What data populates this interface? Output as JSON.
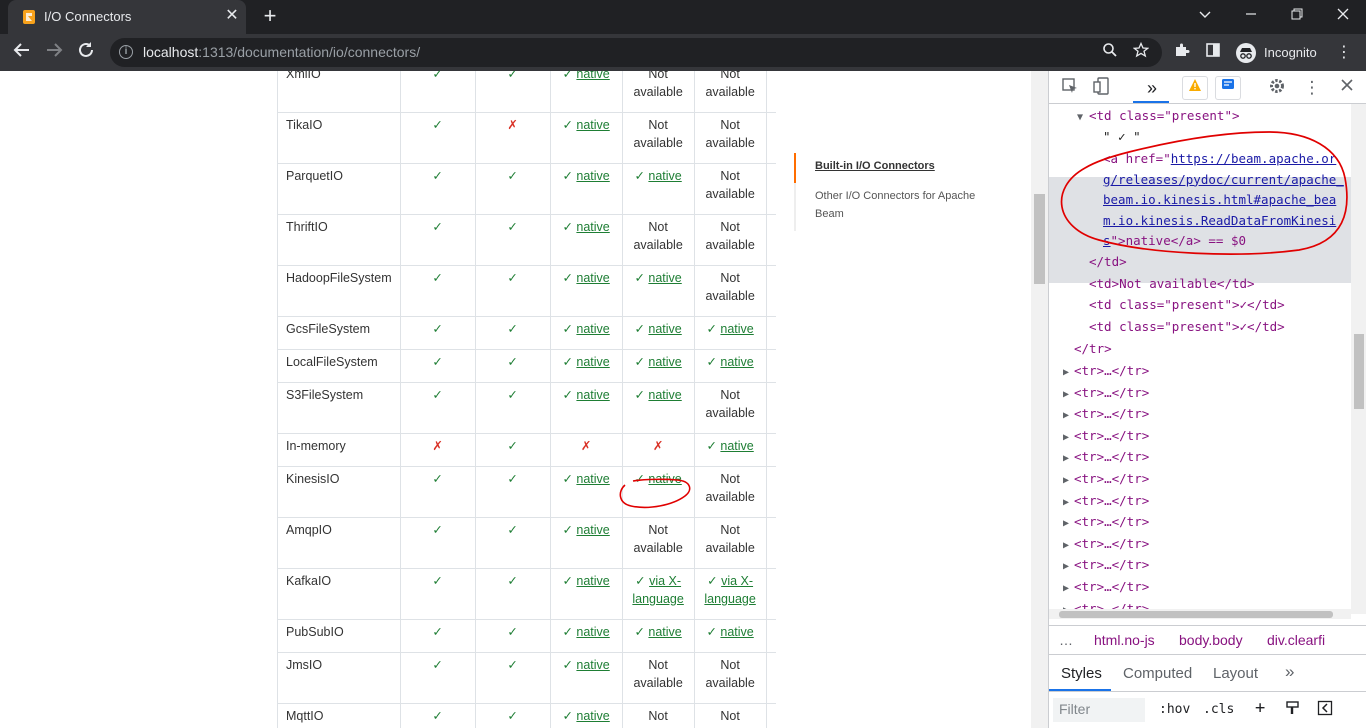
{
  "browser": {
    "tab_title": "I/O Connectors",
    "tab_close": "✕",
    "new_tab": "+",
    "url_host": "localhost",
    "url_path": ":1313/documentation/io/connectors/",
    "profile_label": "Incognito"
  },
  "connectors_table": {
    "rows": [
      {
        "name": "XmlIO",
        "c1": "✓",
        "c2": "✓",
        "c3": "native",
        "c4": "Not available",
        "c5": "Not available"
      },
      {
        "name": "TikaIO",
        "c1": "✓",
        "c2": "✗",
        "c3": "native",
        "c4": "Not available",
        "c5": "Not available"
      },
      {
        "name": "ParquetIO",
        "c1": "✓",
        "c2": "✓",
        "c3": "native",
        "c4": "native",
        "c5": "Not available"
      },
      {
        "name": "ThriftIO",
        "c1": "✓",
        "c2": "✓",
        "c3": "native",
        "c4": "Not available",
        "c5": "Not available"
      },
      {
        "name": "HadoopFileSystem",
        "c1": "✓",
        "c2": "✓",
        "c3": "native",
        "c4": "native",
        "c5": "Not available"
      },
      {
        "name": "GcsFileSystem",
        "c1": "✓",
        "c2": "✓",
        "c3": "native",
        "c4": "native",
        "c5": "native"
      },
      {
        "name": "LocalFileSystem",
        "c1": "✓",
        "c2": "✓",
        "c3": "native",
        "c4": "native",
        "c5": "native"
      },
      {
        "name": "S3FileSystem",
        "c1": "✓",
        "c2": "✓",
        "c3": "native",
        "c4": "native",
        "c5": "Not available"
      },
      {
        "name": "In-memory",
        "c1": "✗",
        "c2": "✓",
        "c3": "✗",
        "c4": "✗",
        "c5": "native"
      },
      {
        "name": "KinesisIO",
        "c1": "✓",
        "c2": "✓",
        "c3": "native",
        "c4": "native",
        "c5": "Not available"
      },
      {
        "name": "AmqpIO",
        "c1": "✓",
        "c2": "✓",
        "c3": "native",
        "c4": "Not available",
        "c5": "Not available"
      },
      {
        "name": "KafkaIO",
        "c1": "✓",
        "c2": "✓",
        "c3": "native",
        "c4": "via X-language",
        "c5": "via X-language"
      },
      {
        "name": "PubSubIO",
        "c1": "✓",
        "c2": "✓",
        "c3": "native",
        "c4": "native",
        "c5": "native"
      },
      {
        "name": "JmsIO",
        "c1": "✓",
        "c2": "✓",
        "c3": "native",
        "c4": "Not available",
        "c5": "Not available"
      },
      {
        "name": "MqttIO",
        "c1": "✓",
        "c2": "✓",
        "c3": "native",
        "c4": "Not available",
        "c5": "Not available"
      }
    ]
  },
  "toc": {
    "items": [
      "Built-in I/O Connectors",
      "Other I/O Connectors for Apache Beam"
    ]
  },
  "devtools": {
    "lines": {
      "l1": "<td class=\"present\">",
      "l2": "\" ✓ \"",
      "l3_pre": "<a href=\"",
      "href": "https://beam.apache.org/releases/pydoc/current/apache_beam.io.kinesis.html#apache_beam.io.kinesis.ReadDataFromKinesis",
      "l3_post": "\">native</a> == $0",
      "l4": "</td>",
      "l5": "<td>Not available</td>",
      "l6": "<td class=\"present\">✓</td>",
      "l7": "<td class=\"present\">✓</td>",
      "l8": "</tr>",
      "tr_collapsed": "<tr>…</tr>"
    },
    "breadcrumbs": [
      "html.no-js",
      "body.body",
      "div.clearfi"
    ],
    "breadcrumb_more": "…",
    "style_tabs": [
      "Styles",
      "Computed",
      "Layout"
    ],
    "filter_placeholder": "Filter",
    "hov": ":hov",
    ".cls": ".cls"
  },
  "colors": {
    "check_green": "#1e7e34",
    "cross_red": "#d93025",
    "toc_accent": "#ff6d00",
    "annotation_red": "#e00000"
  }
}
